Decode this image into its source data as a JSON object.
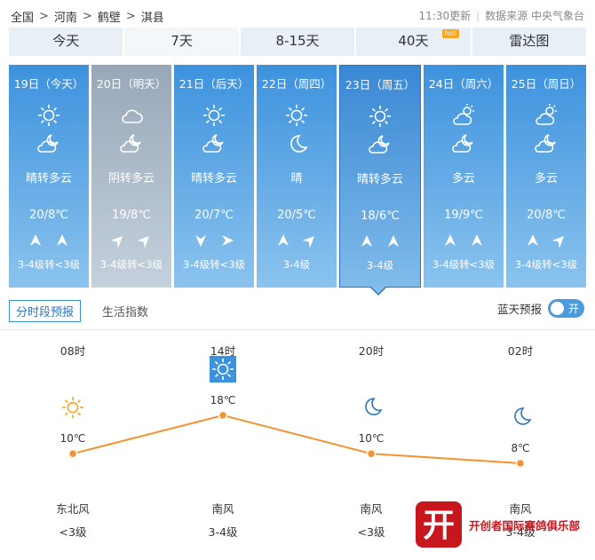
{
  "breadcrumb": [
    "全国",
    "河南",
    "鹤壁",
    "淇县"
  ],
  "update": {
    "time_text": "11:30更新",
    "source_text": "数据来源 中央气象台"
  },
  "tabs": [
    "今天",
    "7天",
    "8-15天",
    "40天",
    "雷达图"
  ],
  "active_tab": "7天",
  "hot_badge": "hot",
  "days": [
    {
      "label": "19日（今天）",
      "icon_day": "sun-icon",
      "icon_night": "partly-cloudy-night-icon",
      "desc": "晴转多云",
      "temp": "20/8℃",
      "wind_dirs": [
        "north-arrow-icon",
        "north-arrow-icon"
      ],
      "level": "3-4级转<3级"
    },
    {
      "label": "20日（明天）",
      "icon_day": "cloud-icon",
      "icon_night": "partly-cloudy-night-icon",
      "desc": "阴转多云",
      "temp": "19/8℃",
      "wind_dirs": [
        "northeast-arrow-icon",
        "northeast-arrow-icon"
      ],
      "level": "3-4级转<3级"
    },
    {
      "label": "21日（后天）",
      "icon_day": "sun-icon",
      "icon_night": "partly-cloudy-night-icon",
      "desc": "晴转多云",
      "temp": "20/7℃",
      "wind_dirs": [
        "south-arrow-icon",
        "east-arrow-icon"
      ],
      "level": "3-4级转<3级"
    },
    {
      "label": "22日（周四）",
      "icon_day": "sun-icon",
      "icon_night": "moon-icon",
      "desc": "晴",
      "temp": "20/5℃",
      "wind_dirs": [
        "north-arrow-icon",
        "northeast-arrow-icon"
      ],
      "level": "3-4级"
    },
    {
      "label": "23日（周五）",
      "icon_day": "sun-icon",
      "icon_night": "partly-cloudy-night-icon",
      "desc": "晴转多云",
      "temp": "18/6℃",
      "wind_dirs": [
        "north-arrow-icon",
        "north-arrow-icon"
      ],
      "level": "3-4级"
    },
    {
      "label": "24日（周六）",
      "icon_day": "partly-cloudy-day-icon",
      "icon_night": "partly-cloudy-night-icon",
      "desc": "多云",
      "temp": "19/9℃",
      "wind_dirs": [
        "north-arrow-icon",
        "north-arrow-icon"
      ],
      "level": "3-4级转<3级"
    },
    {
      "label": "25日（周日）",
      "icon_day": "partly-cloudy-day-icon",
      "icon_night": "partly-cloudy-night-icon",
      "desc": "多云",
      "temp": "20/8℃",
      "wind_dirs": [
        "north-arrow-icon",
        "northeast-arrow-icon"
      ],
      "level": "3-4级转<3级"
    }
  ],
  "selected_day": 4,
  "subtabs": {
    "hourly": "分时段预报",
    "life": "生活指数"
  },
  "bluesky": {
    "label": "蓝天预报",
    "toggle": "开"
  },
  "chart_data": {
    "type": "line",
    "x": [
      "08时",
      "14时",
      "20时",
      "02时"
    ],
    "series": [
      {
        "values": [
          10,
          18,
          10,
          8
        ]
      }
    ],
    "value_labels": [
      "10℃",
      "18℃",
      "10℃",
      "8℃"
    ],
    "icons": [
      "sun-icon",
      "sun-icon",
      "moon-icon",
      "moon-icon"
    ],
    "icon_highlight": [
      false,
      true,
      false,
      false
    ],
    "wind_dir": [
      "东北风",
      "南风",
      "南风",
      "南风"
    ],
    "wind_level": [
      "<3级",
      "3-4级",
      "<3级",
      "3-4级"
    ],
    "line_color": "#f5922f"
  },
  "watermark": {
    "text": "开创者国际赛鸽俱乐部",
    "seal_char": "开"
  },
  "colors": {
    "tab_bg": "#e8eff6",
    "card_blue": "#3d92dd",
    "card_gray": "#98a8b9",
    "accent": "#3b8ed8",
    "line": "#f5922f",
    "sun": "#f5a623"
  }
}
